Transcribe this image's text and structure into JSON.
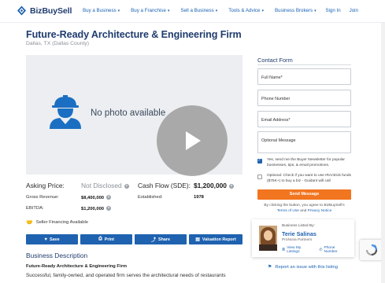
{
  "header": {
    "logo_text": "BizBuySell",
    "nav": [
      {
        "label": "Buy a Business"
      },
      {
        "label": "Buy a Franchise"
      },
      {
        "label": "Sell a Business"
      },
      {
        "label": "Tools & Advice"
      },
      {
        "label": "Business Brokers"
      }
    ],
    "sign_in": "Sign In",
    "join": "Join"
  },
  "listing": {
    "title": "Future-Ready Architecture & Engineering Firm",
    "location": "Dallas, TX (Dallas County)",
    "no_photo": "No photo available",
    "asking_label": "Asking Price:",
    "asking_value": "Not Disclosed",
    "cashflow_label": "Cash Flow (SDE):",
    "cashflow_value": "$1,200,000",
    "gross_label": "Gross Revenue:",
    "gross_value": "$8,400,000",
    "ebitda_label": "EBITDA:",
    "ebitda_value": "$1,200,000",
    "established_label": "Established:",
    "established_value": "1978",
    "seller_financing": "Seller Financing Available"
  },
  "actions": {
    "save": "Save",
    "print": "Print",
    "share": "Share",
    "valuation": "Valuation Report"
  },
  "description": {
    "heading": "Business Description",
    "subheading": "Future-Ready Architecture & Engineering Firm",
    "body": "Successful, family-owned, and operated firm serves the architectural needs of restaurants"
  },
  "contact_form": {
    "title": "Contact Form",
    "full_name_placeholder": "Full Name*",
    "phone_placeholder": "Phone Number",
    "email_placeholder": "Email Address*",
    "message_placeholder": "Optional Message",
    "newsletter_text": "Yes, send me the Buyer Newsletter for popular businesses, tips, & email promotions.",
    "optional_text": "Optional: Check if you want to use IRA/401k funds ($75K+) to buy a biz - Guidant will call",
    "send_label": "Send Message",
    "terms_prefix": "By clicking the button, you agree to BizBuySell's",
    "terms_link": "Terms of Use",
    "terms_and": "and",
    "privacy_link": "Privacy Notice"
  },
  "broker": {
    "label": "Business Listed By:",
    "name": "Terie Salinas",
    "firm": "ProNova Partners",
    "listings_link": "View My Listings",
    "phone_link": "Phone Number"
  },
  "report_text": "Report an issue with this listing",
  "colors": {
    "brand_navy": "#1f3c6e",
    "button_blue": "#1f62b0",
    "send_orange": "#f2751f",
    "link_blue": "#1b63b5"
  }
}
